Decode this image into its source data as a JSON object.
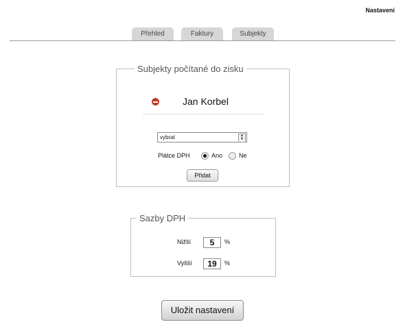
{
  "header": {
    "settings_link": "Nastavení"
  },
  "tabs": [
    {
      "label": "Přehled"
    },
    {
      "label": "Faktury"
    },
    {
      "label": "Subjekty"
    }
  ],
  "subjects_panel": {
    "title": "Subjekty počítané do zisku",
    "subjects": [
      {
        "name": "Jan Korbel"
      }
    ],
    "select_value": "vybrat",
    "vat_payer_label": "Plátce DPH",
    "radio_yes_label": "Ano",
    "radio_no_label": "Ne",
    "vat_payer_selected": "Ano",
    "add_button": "Přidat"
  },
  "vat_panel": {
    "title": "Sazby DPH",
    "lower_label": "Nižší",
    "lower_value": "5",
    "higher_label": "Vyšší",
    "higher_value": "19",
    "unit": "%"
  },
  "save_button": "Uložit nastavení",
  "colors": {
    "remove_icon": "#c0392b",
    "tab_background": "#d6d6d6"
  }
}
